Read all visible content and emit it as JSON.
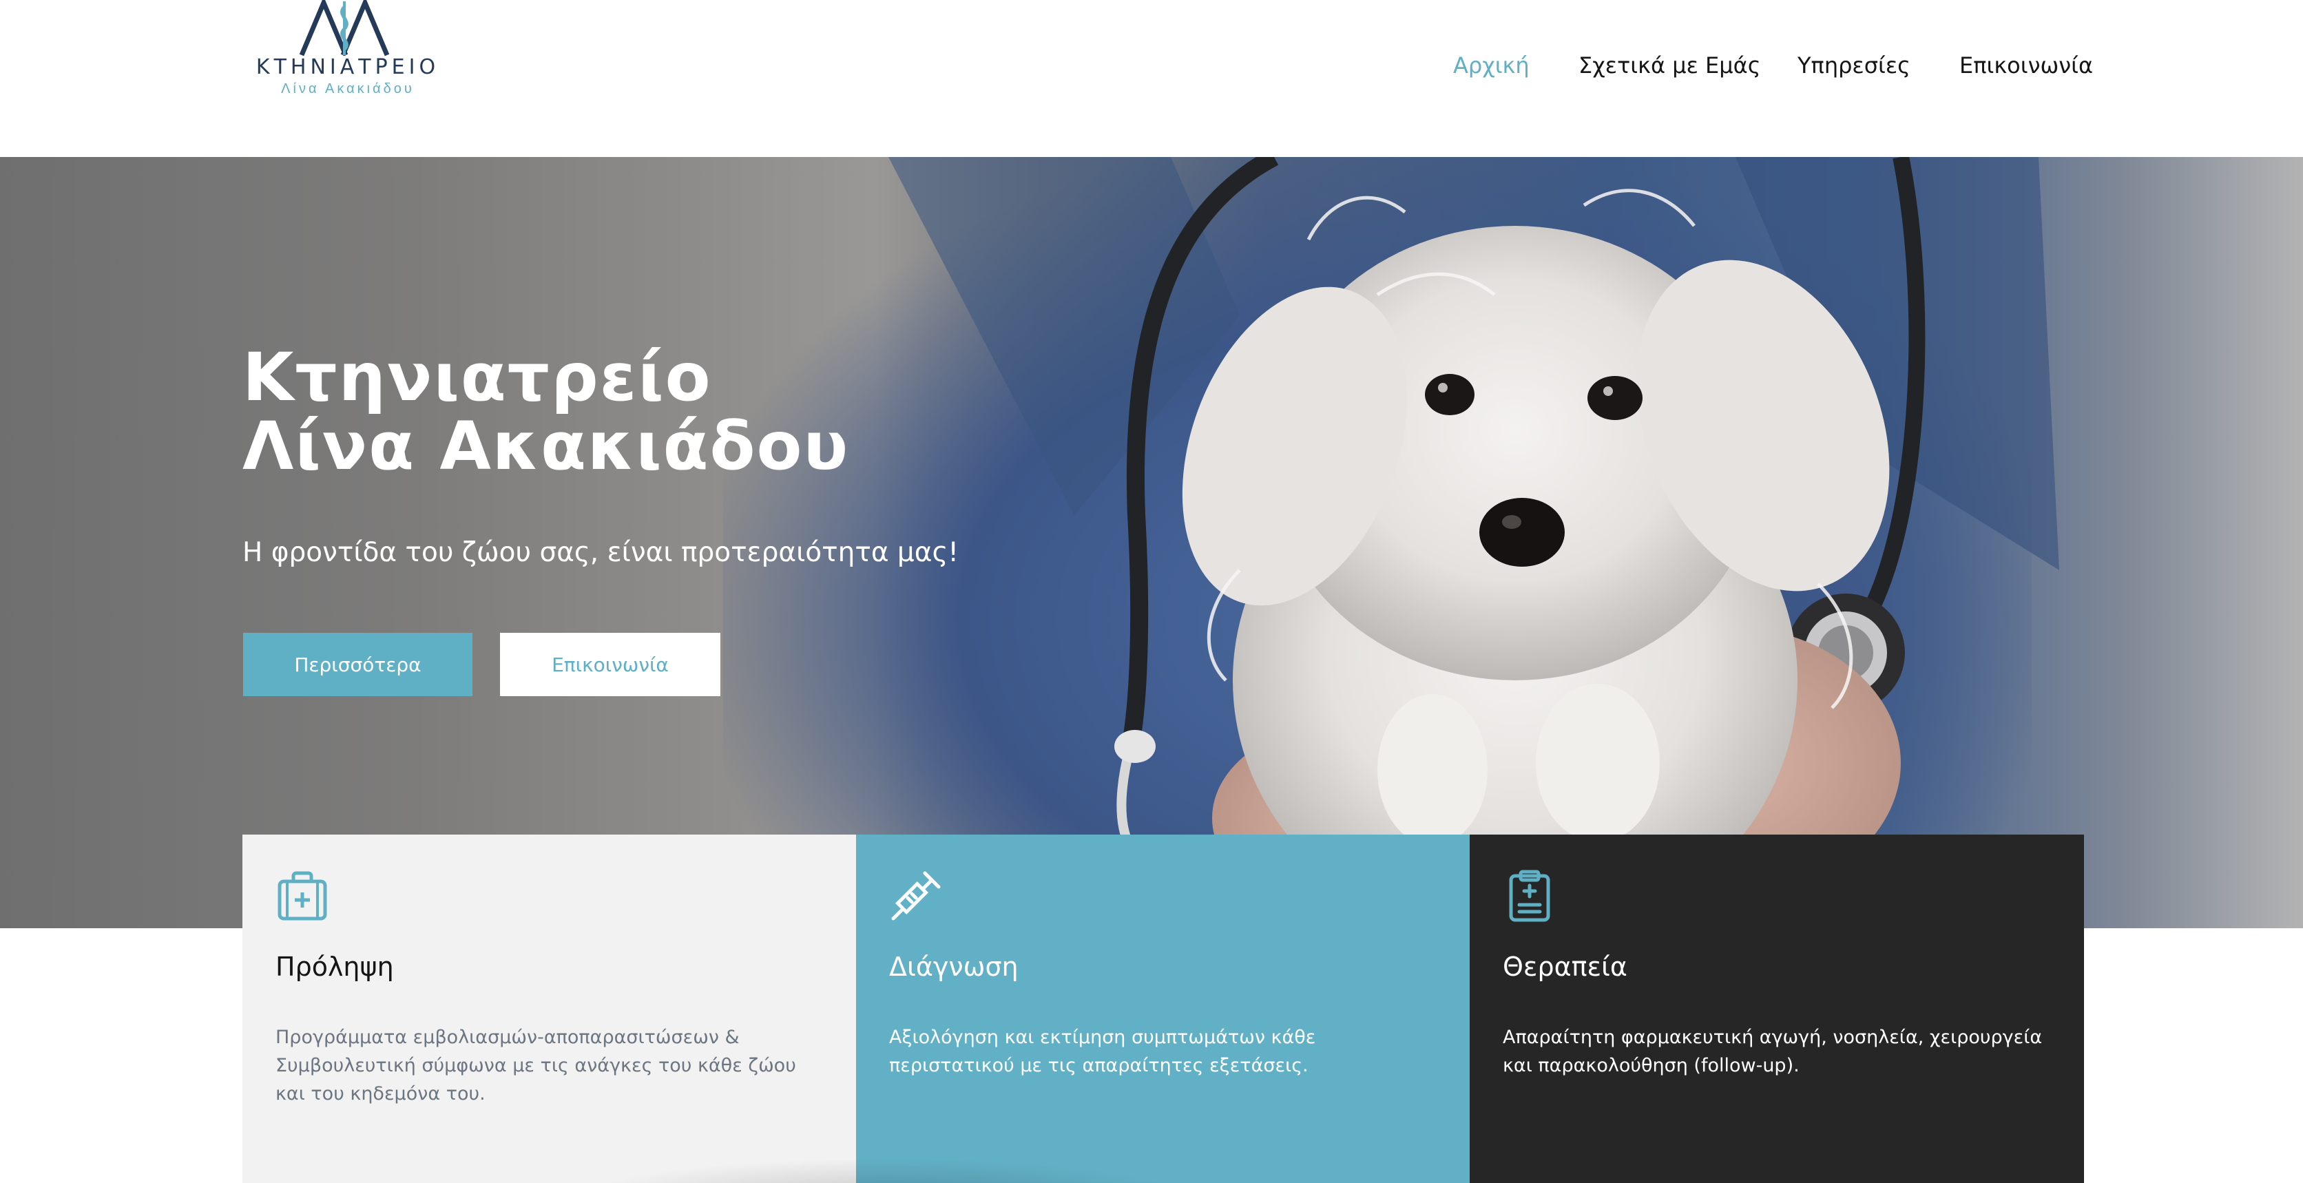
{
  "header": {
    "logo": {
      "title": "ΚΤΗΝΙΑΤΡΕΙΟ",
      "subtitle": "Λίνα Ακακιάδου"
    },
    "nav": [
      {
        "label": "Αρχική",
        "active": true
      },
      {
        "label": "Σχετικά με Εμάς",
        "active": false
      },
      {
        "label": "Υπηρεσίες",
        "active": false
      },
      {
        "label": "Επικοινωνία",
        "active": false
      }
    ]
  },
  "hero": {
    "title_line1": "Κτηνιατρείο",
    "title_line2": "Λίνα Ακακιάδου",
    "subtitle": "Η φροντίδα του ζώου σας, είναι προτεραιότητα μας!",
    "primary_button": "Περισσότερα",
    "secondary_button": "Επικοινωνία"
  },
  "cards": [
    {
      "icon": "medical-kit-icon",
      "title": "Πρόληψη",
      "text": "Προγράμματα εμβολιασμών-αποπαρασιτώσεων & Συμβουλευτική σύμφωνα με τις ανάγκες του κάθε ζώου και του κηδεμόνα του."
    },
    {
      "icon": "syringe-icon",
      "title": "Διάγνωση",
      "text": "Αξιολόγηση και εκτίμηση συμπτωμάτων κάθε περιστατικού με τις απαραίτητες εξετάσεις."
    },
    {
      "icon": "medical-clipboard-icon",
      "title": "Θεραπεία",
      "text": "Απαραίτητη φαρμακευτική αγωγή, νοσηλεία, χειρουργεία και παρακολούθηση (follow-up)."
    }
  ],
  "colors": {
    "accent": "#5fb0c5",
    "navy": "#253a58",
    "card_light": "#f2f2f2",
    "card_accent": "#62b0c6",
    "card_dark": "#262626"
  }
}
